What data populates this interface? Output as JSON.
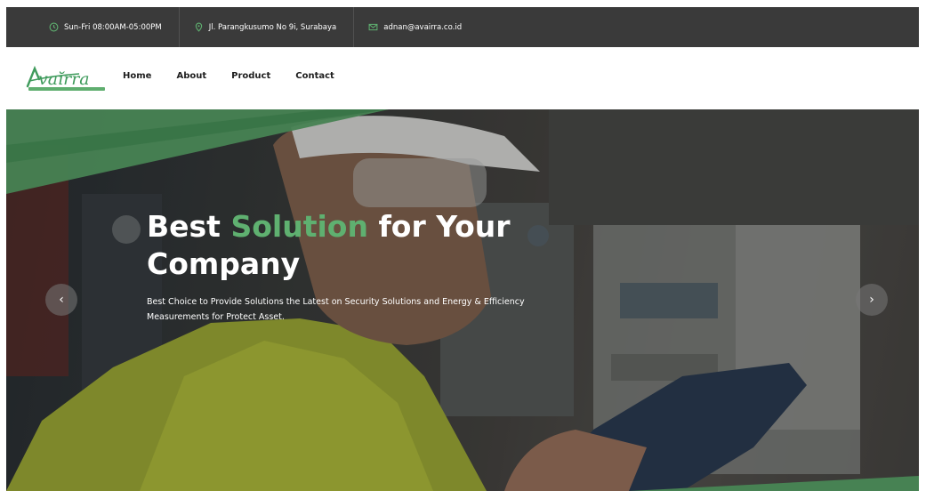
{
  "topbar": {
    "hours": "Sun-Fri 08:00AM-05:00PM",
    "address": "Jl. Parangkusumo No 9i, Surabaya",
    "email": "adnan@avairra.co.id"
  },
  "brand": {
    "logo_text": "Avaĭrra",
    "accent_color": "#3f9b5c"
  },
  "nav": {
    "items": [
      {
        "label": "Home"
      },
      {
        "label": "About"
      },
      {
        "label": "Product"
      },
      {
        "label": "Contact"
      }
    ]
  },
  "hero": {
    "title_part1": "Best ",
    "title_accent": "Solution",
    "title_part2": " for Your Company",
    "subtitle": "Best Choice to Provide Solutions the Latest on Security Solutions and Energy & Efficiency Measurements for Protect Asset.",
    "prev_label": "‹",
    "next_label": "›"
  }
}
